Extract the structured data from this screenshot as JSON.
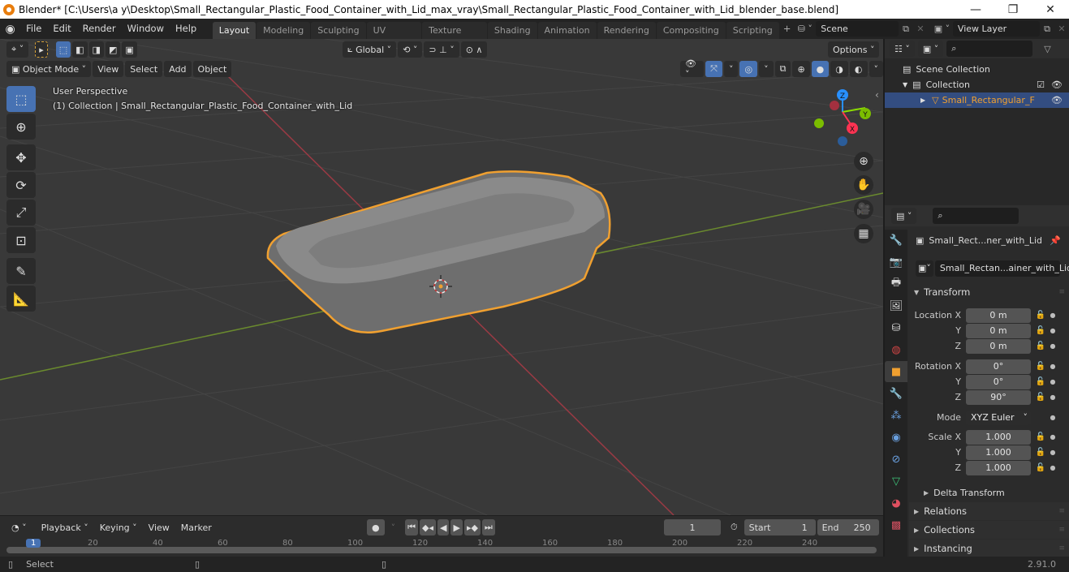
{
  "window": {
    "title": "Blender* [C:\\Users\\a y\\Desktop\\Small_Rectangular_Plastic_Food_Container_with_Lid_max_vray\\Small_Rectangular_Plastic_Food_Container_with_Lid_blender_base.blend]",
    "minimize": "—",
    "maximize": "❐",
    "close": "✕"
  },
  "menu": [
    "File",
    "Edit",
    "Render",
    "Window",
    "Help"
  ],
  "workspaces": [
    "Layout",
    "Modeling",
    "Sculpting",
    "UV Editing",
    "Texture Paint",
    "Shading",
    "Animation",
    "Rendering",
    "Compositing",
    "Scripting"
  ],
  "active_workspace": "Layout",
  "add_workspace": "+",
  "scene": {
    "label": "Scene",
    "view_layer": "View Layer"
  },
  "viewport": {
    "mode": "Object Mode",
    "header_menus": [
      "View",
      "Select",
      "Add",
      "Object"
    ],
    "transform_orientation": "Global",
    "options_label": "Options",
    "perspective_label": "User Perspective",
    "collection_label": "(1) Collection | Small_Rectangular_Plastic_Food_Container_with_Lid",
    "gizmo_axes": {
      "x": "X",
      "y": "Y",
      "z": "Z"
    }
  },
  "outliner": {
    "search_placeholder": "",
    "items": [
      {
        "label": "Scene Collection"
      },
      {
        "label": "Collection"
      },
      {
        "label": "Small_Rectangular_F"
      }
    ]
  },
  "properties": {
    "object_name": "Small_Rect...ner_with_Lid",
    "data_name": "Small_Rectan...ainer_with_Lid",
    "transform_label": "Transform",
    "location": {
      "label": "Location X",
      "x": "0 m",
      "y": "0 m",
      "z": "0 m"
    },
    "rotation": {
      "label": "Rotation X",
      "x": "0°",
      "y": "0°",
      "z": "90°"
    },
    "mode": {
      "label": "Mode",
      "value": "XYZ Euler"
    },
    "scale": {
      "label": "Scale X",
      "x": "1.000",
      "y": "1.000",
      "z": "1.000"
    },
    "axis_y": "Y",
    "axis_z": "Z",
    "subpanels": [
      "Delta Transform",
      "Relations",
      "Collections",
      "Instancing"
    ]
  },
  "timeline": {
    "menus": [
      "Playback",
      "Keying",
      "View",
      "Marker"
    ],
    "current_frame": "1",
    "start_label": "Start",
    "start": "1",
    "end_label": "End",
    "end": "250",
    "ruler_ticks": [
      "1",
      "20",
      "40",
      "60",
      "80",
      "100",
      "120",
      "140",
      "160",
      "180",
      "200",
      "220",
      "240"
    ]
  },
  "status": {
    "left_action": "Select",
    "version": "2.91.0"
  },
  "colors": {
    "accent": "#4772b3",
    "selection_outline": "#f0a030",
    "x_axis": "#ff3352",
    "y_axis": "#8bdc00",
    "z_axis": "#2890ff"
  }
}
